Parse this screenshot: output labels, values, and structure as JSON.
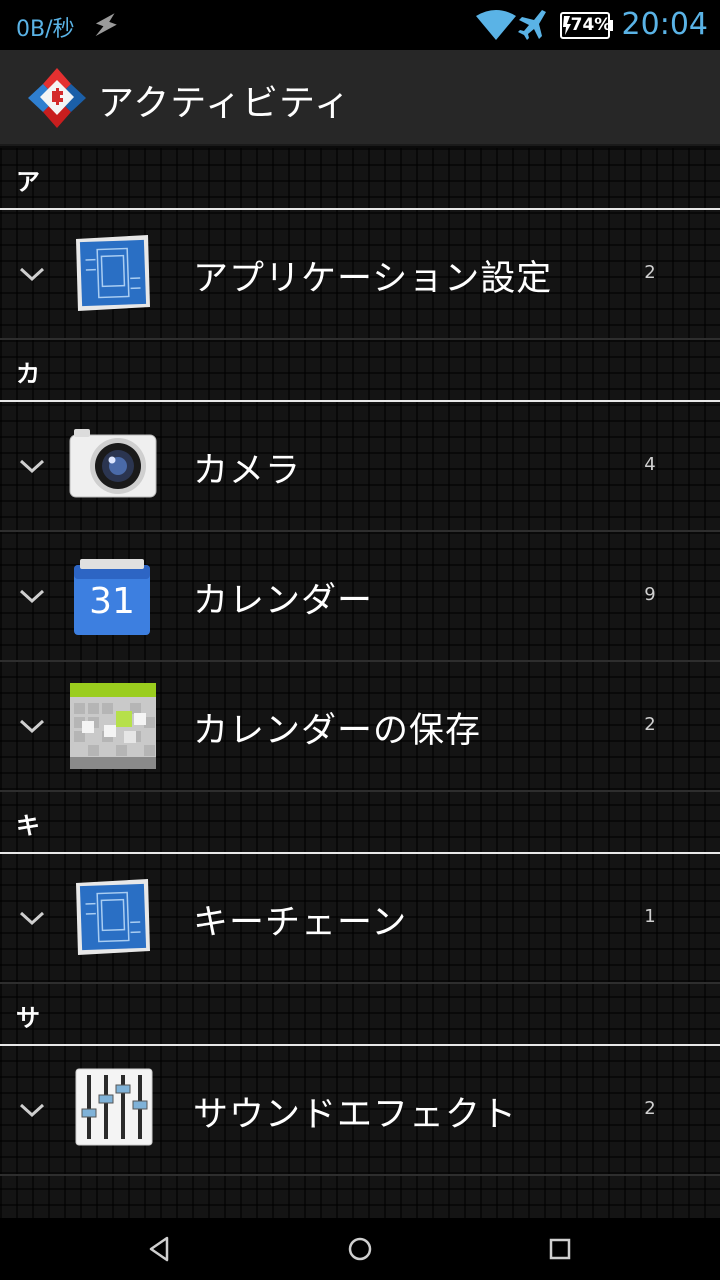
{
  "status_bar": {
    "speed": "0B/秒",
    "battery_percent": "74%",
    "time": "20:04",
    "accent_color": "#5ab3e6",
    "icons": [
      "flash-icon",
      "wifi-icon",
      "airplane-icon",
      "battery-icon"
    ]
  },
  "action_bar": {
    "title": "アクティビティ",
    "logo_icon": "nova-launcher-logo"
  },
  "sections": [
    {
      "header": "ア",
      "items": [
        {
          "label": "アプリケーション設定",
          "count": "2",
          "icon": "blueprint-icon"
        }
      ]
    },
    {
      "header": "カ",
      "items": [
        {
          "label": "カメラ",
          "count": "4",
          "icon": "camera-icon"
        },
        {
          "label": "カレンダー",
          "count": "9",
          "icon": "calendar-icon",
          "icon_text": "31"
        },
        {
          "label": "カレンダーの保存",
          "count": "2",
          "icon": "calendar-storage-icon"
        }
      ]
    },
    {
      "header": "キ",
      "items": [
        {
          "label": "キーチェーン",
          "count": "1",
          "icon": "blueprint-icon"
        }
      ]
    },
    {
      "header": "サ",
      "items": [
        {
          "label": "サウンドエフェクト",
          "count": "2",
          "icon": "equalizer-icon"
        }
      ]
    }
  ],
  "nav_bar": {
    "icons": [
      "back-icon",
      "home-icon",
      "recents-icon"
    ]
  }
}
